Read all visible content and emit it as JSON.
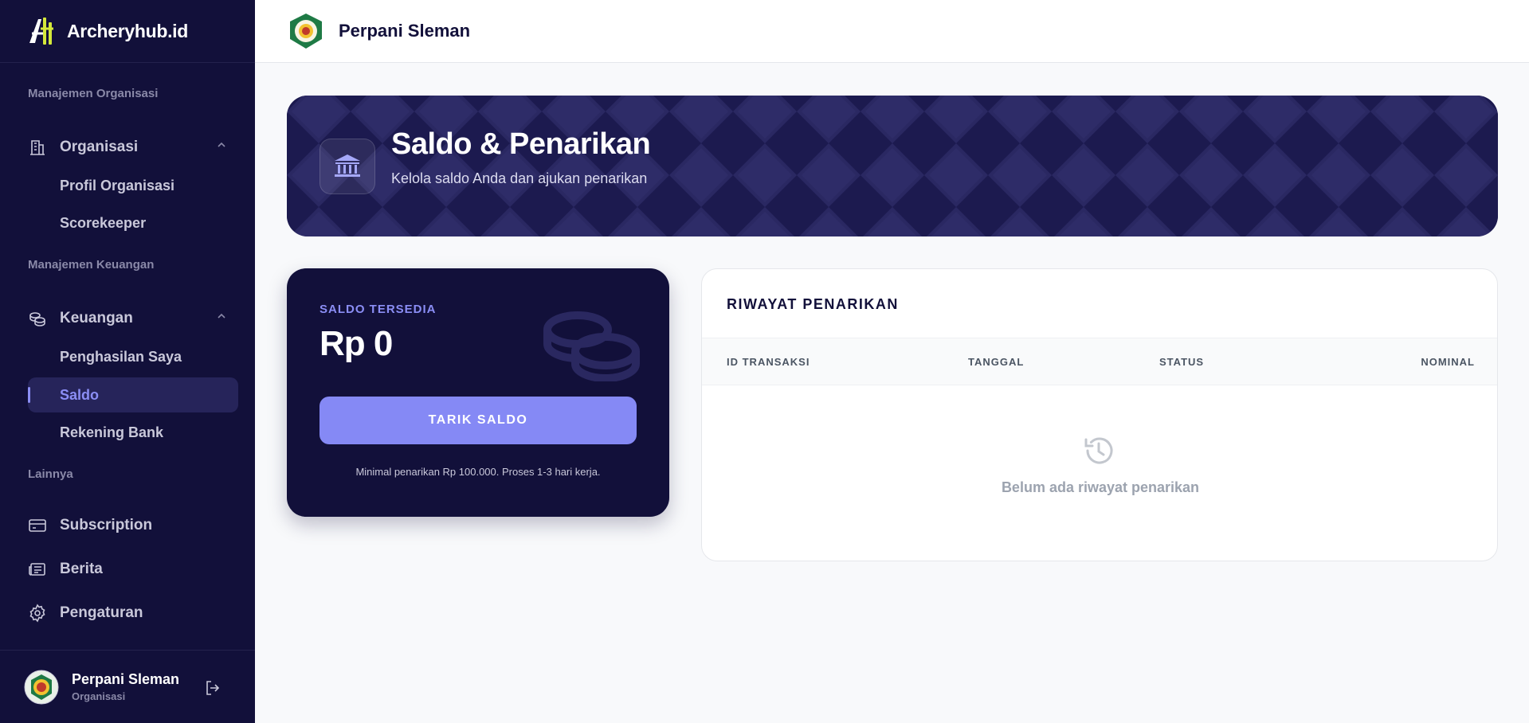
{
  "brand": {
    "name": "Archeryhub.id"
  },
  "sidebar": {
    "sections": [
      {
        "label": "Manajemen Organisasi"
      },
      {
        "label": "Manajemen Keuangan"
      },
      {
        "label": "Lainnya"
      }
    ],
    "organisasi": {
      "label": "Organisasi",
      "items": [
        {
          "label": "Profil Organisasi"
        },
        {
          "label": "Scorekeeper"
        }
      ]
    },
    "keuangan": {
      "label": "Keuangan",
      "items": [
        {
          "label": "Penghasilan Saya"
        },
        {
          "label": "Saldo",
          "active": true
        },
        {
          "label": "Rekening Bank"
        }
      ]
    },
    "others": [
      {
        "label": "Subscription"
      },
      {
        "label": "Berita"
      },
      {
        "label": "Pengaturan"
      }
    ],
    "user": {
      "name": "Perpani Sleman",
      "role": "Organisasi"
    }
  },
  "topbar": {
    "title": "Perpani Sleman"
  },
  "hero": {
    "title": "Saldo & Penarikan",
    "subtitle": "Kelola saldo Anda dan ajukan penarikan"
  },
  "balance": {
    "label": "SALDO TERSEDIA",
    "value": "Rp 0",
    "button": "TARIK SALDO",
    "note": "Minimal penarikan Rp 100.000. Proses 1-3 hari kerja."
  },
  "history": {
    "title": "RIWAYAT PENARIKAN",
    "columns": [
      "ID TRANSAKSI",
      "TANGGAL",
      "STATUS",
      "NOMINAL"
    ],
    "empty_text": "Belum ada riwayat penarikan"
  },
  "colors": {
    "sidebar_bg": "#12103a",
    "accent": "#8589f5",
    "hero_bg": "#1c1a4f"
  }
}
